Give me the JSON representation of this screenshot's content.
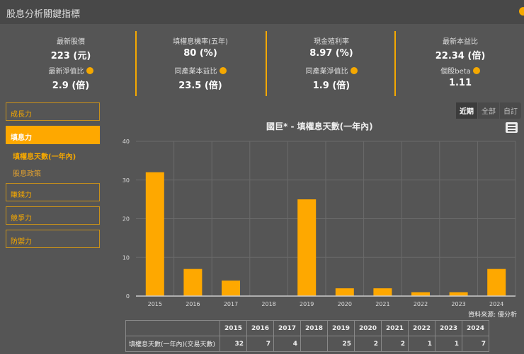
{
  "header": {
    "title": "股息分析關鍵指標"
  },
  "metrics": [
    {
      "label": "最新股價",
      "value": "223 (元)",
      "label2": "最新淨值比",
      "value2": "2.9 (倍)"
    },
    {
      "label": "填權息機率(五年)",
      "value": "80 (%)",
      "label2": "同產業本益比",
      "value2": "23.5 (倍)"
    },
    {
      "label": "現金殖利率",
      "value": "8.97 (%)",
      "label2": "同產業淨值比",
      "value2": "1.9 (倍)"
    },
    {
      "label": "最新本益比",
      "value": "22.34 (倍)",
      "label2": "個股beta",
      "value2": "1.11"
    }
  ],
  "sidebar": {
    "items": [
      "成長力",
      "填息力",
      "賺錢力",
      "競爭力",
      "防禦力"
    ],
    "sub": [
      "填權息天數(一年內)",
      "股息政策"
    ]
  },
  "tabs": [
    "近期",
    "全部",
    "自訂"
  ],
  "chart_data": {
    "type": "bar",
    "title": "國巨* - 填權息天數(一年內)",
    "categories": [
      "2015",
      "2016",
      "2017",
      "2018",
      "2019",
      "2020",
      "2021",
      "2022",
      "2023",
      "2024"
    ],
    "values": [
      32,
      7,
      4,
      null,
      25,
      2,
      2,
      1,
      1,
      7
    ],
    "ylim": [
      0,
      40
    ],
    "yticks": [
      "0",
      "10",
      "20",
      "30",
      "40"
    ],
    "color": "#fea800",
    "source": "資料來源: 優分析"
  },
  "table": {
    "row_label": "填權息天數(一年內)(交易天數)",
    "cells": [
      "32",
      "7",
      "4",
      "",
      "25",
      "2",
      "2",
      "1",
      "1",
      "7"
    ]
  }
}
